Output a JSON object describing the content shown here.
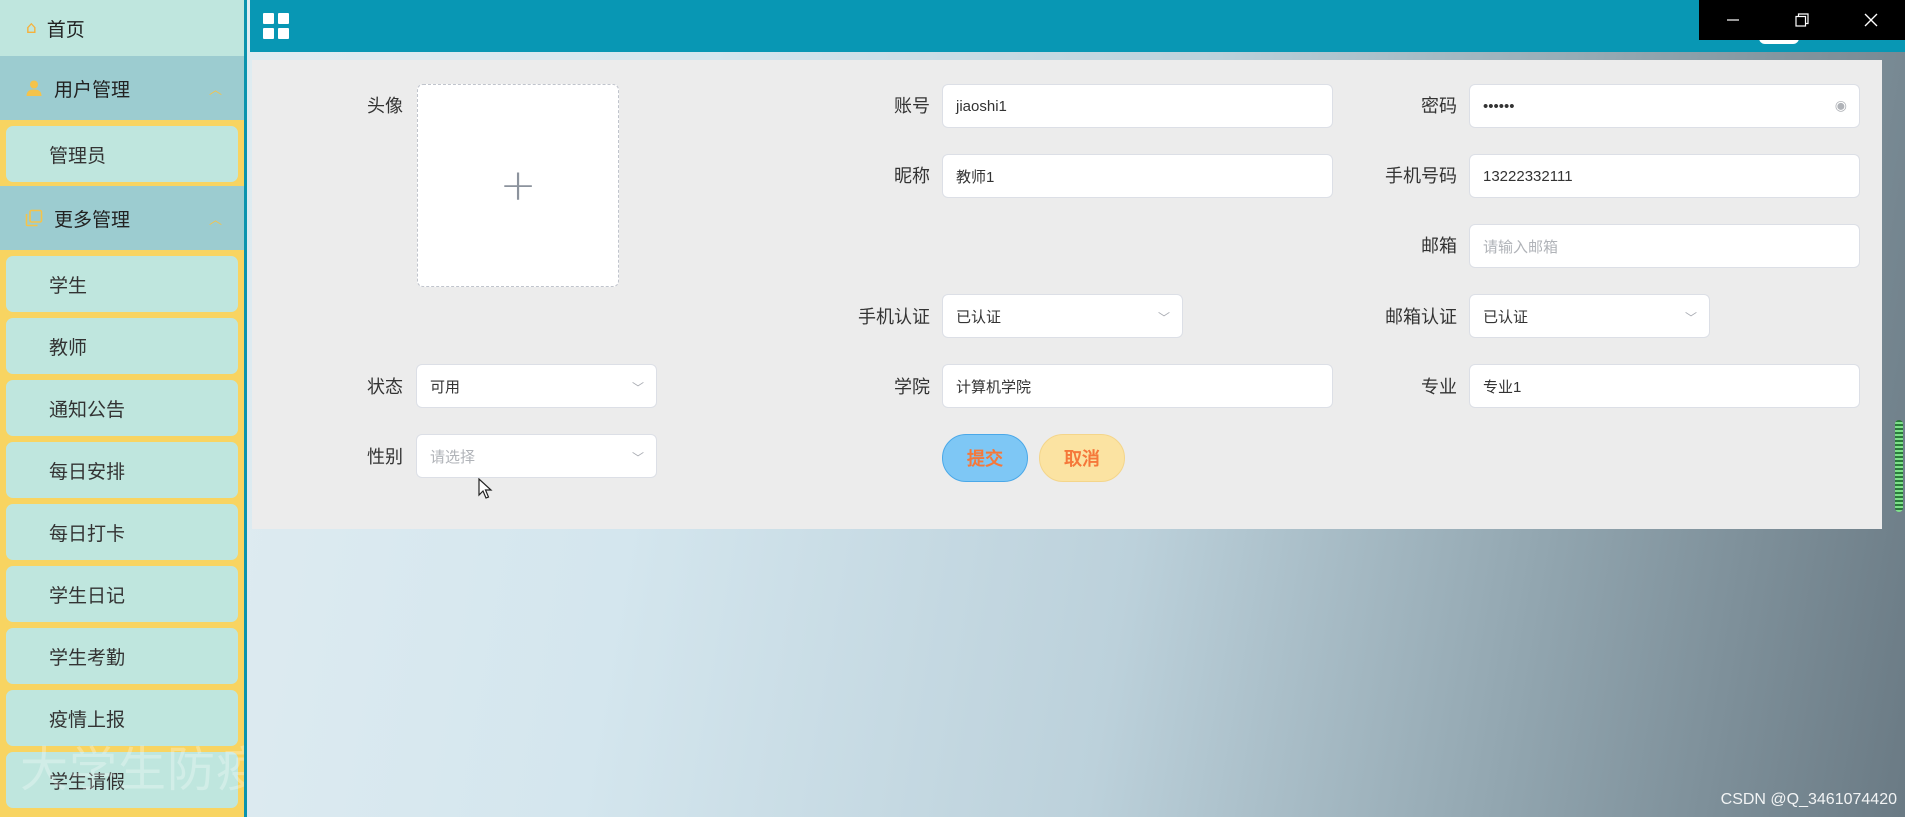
{
  "sidebar": {
    "home_label": "首页",
    "groups": [
      {
        "label": "用户管理",
        "items": [
          {
            "label": "管理员"
          }
        ]
      },
      {
        "label": "更多管理",
        "items": [
          {
            "label": "学生"
          },
          {
            "label": "教师"
          },
          {
            "label": "通知公告"
          },
          {
            "label": "每日安排"
          },
          {
            "label": "每日打卡"
          },
          {
            "label": "学生日记"
          },
          {
            "label": "学生考勤"
          },
          {
            "label": "疫情上报"
          },
          {
            "label": "学生请假"
          }
        ]
      }
    ],
    "watermark": "大学生防疫封校管理系统 演示录像"
  },
  "form": {
    "avatar_label": "头像",
    "account_label": "账号",
    "account_value": "jiaoshi1",
    "password_label": "密码",
    "password_value": "••••••",
    "nickname_label": "昵称",
    "nickname_value": "教师1",
    "phone_label": "手机号码",
    "phone_value": "13222332111",
    "email_label": "邮箱",
    "email_placeholder": "请输入邮箱",
    "phone_verify_label": "手机认证",
    "phone_verify_value": "已认证",
    "email_verify_label": "邮箱认证",
    "email_verify_value": "已认证",
    "status_label": "状态",
    "status_value": "可用",
    "college_label": "学院",
    "college_value": "计算机学院",
    "major_label": "专业",
    "major_value": "专业1",
    "gender_label": "性别",
    "gender_placeholder": "请选择",
    "submit_label": "提交",
    "cancel_label": "取消"
  },
  "footer": {
    "credit": "CSDN @Q_3461074420"
  },
  "colors": {
    "topbar": "#0897b4",
    "sidebar": "#f8d461",
    "menu_item": "#bfe6de",
    "button_text": "#f5783a"
  }
}
